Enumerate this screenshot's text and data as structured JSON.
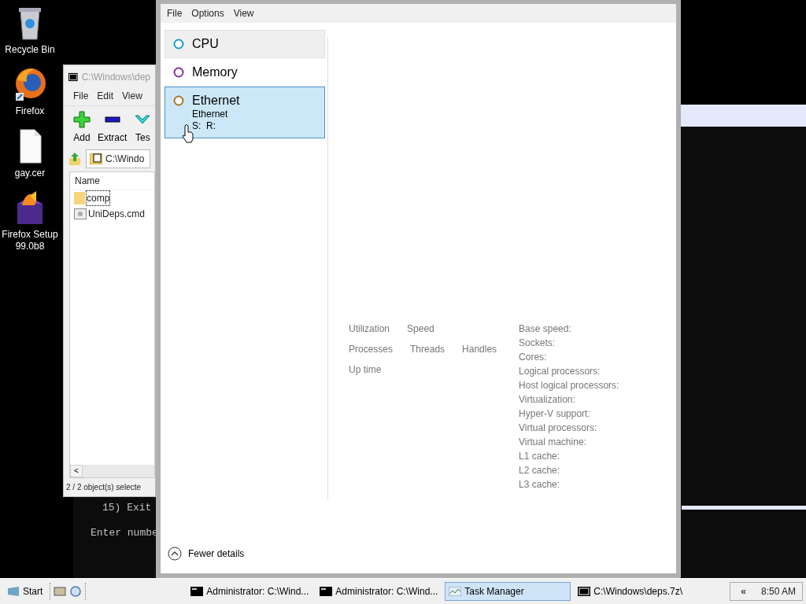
{
  "desktop_icons": [
    {
      "label": "Recycle Bin",
      "kind": "recycle-bin"
    },
    {
      "label": "Firefox",
      "kind": "browser"
    },
    {
      "label": "gay.cer",
      "kind": "document"
    },
    {
      "label": "Firefox Setup 99.0b8",
      "kind": "installer"
    }
  ],
  "console_window": {
    "lines": [
      "15) Exit",
      "Enter numbe"
    ]
  },
  "archive_window": {
    "title": "C:\\Windows\\dep",
    "menu": [
      "File",
      "Edit",
      "View"
    ],
    "toolbar": [
      {
        "label": "Add",
        "kind": "add"
      },
      {
        "label": "Extract",
        "kind": "extract"
      },
      {
        "label": "Tes",
        "kind": "test"
      }
    ],
    "address": "C:\\Windo",
    "column": "Name",
    "files": [
      {
        "name": "comp",
        "kind": "folder",
        "focused": true
      },
      {
        "name": "UniDeps.cmd",
        "kind": "script",
        "focused": false
      }
    ],
    "scroll_button": "<",
    "status": "2 / 2 object(s) selecte"
  },
  "task_manager": {
    "menu": [
      "File",
      "Options",
      "View"
    ],
    "resources": [
      {
        "name": "CPU",
        "color": "#1d9fc9",
        "selected": false,
        "focused": true
      },
      {
        "name": "Memory",
        "color": "#8b2fa3",
        "selected": false,
        "focused": false
      },
      {
        "name": "Ethernet",
        "color": "#a7782a",
        "selected": true,
        "subtitle": "Ethernet",
        "detail": "S:  R:"
      }
    ],
    "stats": [
      [
        "Utilization",
        "Speed"
      ],
      [
        "Processes",
        "Threads",
        "Handles"
      ],
      [
        "Up time"
      ]
    ],
    "specs": [
      "Base speed:",
      "Sockets:",
      "Cores:",
      "Logical processors:",
      "Host logical processors:",
      "Virtualization:",
      "Hyper-V support:",
      "Virtual processors:",
      "Virtual machine:",
      "L1 cache:",
      "L2 cache:",
      "L3 cache:"
    ],
    "fewer_details": "Fewer details"
  },
  "taskbar": {
    "start": "Start",
    "tasks": [
      {
        "label": "Administrator: C:\\Wind...",
        "kind": "console",
        "selected": false
      },
      {
        "label": "Administrator: C:\\Wind...",
        "kind": "console",
        "selected": false
      },
      {
        "label": "Task Manager",
        "kind": "taskmgr",
        "selected": true
      },
      {
        "label": "C:\\Windows\\deps.7z\\",
        "kind": "archive",
        "selected": false
      }
    ],
    "tray_toggle": "«",
    "clock": "8:50 AM"
  }
}
